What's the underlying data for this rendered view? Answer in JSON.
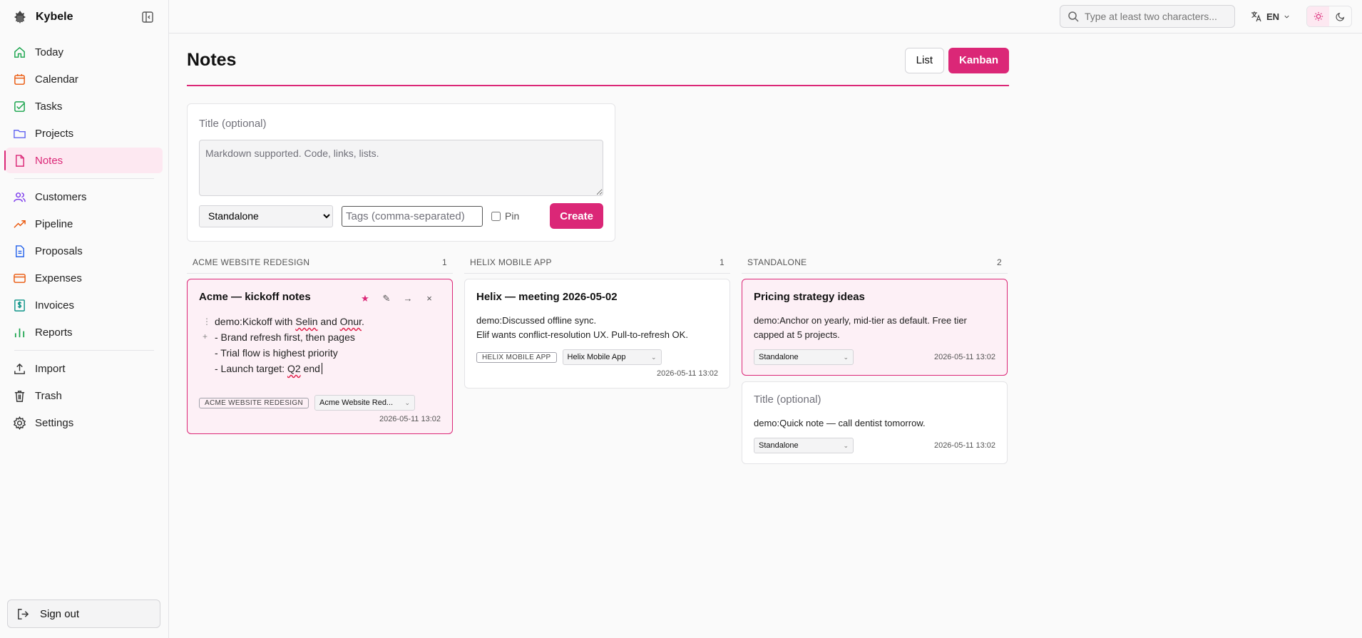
{
  "app": {
    "name": "Kybele"
  },
  "nav": {
    "primary": [
      {
        "key": "today",
        "label": "Today",
        "color": "#16a34a"
      },
      {
        "key": "calendar",
        "label": "Calendar",
        "color": "#ea580c"
      },
      {
        "key": "tasks",
        "label": "Tasks",
        "color": "#16a34a"
      },
      {
        "key": "projects",
        "label": "Projects",
        "color": "#6366f1"
      },
      {
        "key": "notes",
        "label": "Notes",
        "color": "#db2777"
      }
    ],
    "business": [
      {
        "key": "customers",
        "label": "Customers",
        "color": "#7c3aed"
      },
      {
        "key": "pipeline",
        "label": "Pipeline",
        "color": "#ea580c"
      },
      {
        "key": "proposals",
        "label": "Proposals",
        "color": "#2563eb"
      },
      {
        "key": "expenses",
        "label": "Expenses",
        "color": "#ea580c"
      },
      {
        "key": "invoices",
        "label": "Invoices",
        "color": "#0d9488"
      },
      {
        "key": "reports",
        "label": "Reports",
        "color": "#16a34a"
      }
    ],
    "system": [
      {
        "key": "import",
        "label": "Import",
        "color": "#333"
      },
      {
        "key": "trash",
        "label": "Trash",
        "color": "#333"
      },
      {
        "key": "settings",
        "label": "Settings",
        "color": "#333"
      }
    ],
    "sign_out": "Sign out"
  },
  "topbar": {
    "search_placeholder": "Type at least two characters...",
    "language": "EN"
  },
  "page": {
    "title": "Notes",
    "view_list": "List",
    "view_kanban": "Kanban"
  },
  "composer": {
    "title_placeholder": "Title (optional)",
    "body_placeholder": "Markdown supported. Code, links, lists.",
    "project_selected": "Standalone",
    "tags_placeholder": "Tags (comma-separated)",
    "pin_label": "Pin",
    "create_label": "Create"
  },
  "columns": [
    {
      "name": "ACME WEBSITE REDESIGN",
      "count": "1"
    },
    {
      "name": "HELIX MOBILE APP",
      "count": "1"
    },
    {
      "name": "STANDALONE",
      "count": "2"
    }
  ],
  "cards": {
    "acme": {
      "title": "Acme — kickoff notes",
      "actions": {
        "pin": "★",
        "edit": "✎",
        "move": "→",
        "delete": "×"
      },
      "lines": [
        "demo:Kickoff with ",
        "Selin",
        " and ",
        "Onur",
        ".",
        "- Brand refresh first, then pages",
        "- Trial flow is highest priority",
        "- Launch target: ",
        "Q2",
        " end"
      ],
      "badge": "ACME WEBSITE REDESIGN",
      "project": "Acme Website Red...",
      "timestamp": "2026-05-11 13:02"
    },
    "helix": {
      "title": "Helix — meeting 2026-05-02",
      "body_1": "demo:Discussed offline sync.",
      "body_2": "Elif wants conflict-resolution UX. Pull-to-refresh OK.",
      "badge": "HELIX MOBILE APP",
      "project": "Helix Mobile App",
      "timestamp": "2026-05-11 13:02"
    },
    "pricing": {
      "title": "Pricing strategy ideas",
      "body": "demo:Anchor on yearly, mid-tier as default. Free tier capped at 5 projects.",
      "project": "Standalone",
      "timestamp": "2026-05-11 13:02"
    },
    "quick": {
      "title": "Title (optional)",
      "body": "demo:Quick note — call dentist tomorrow.",
      "project": "Standalone",
      "timestamp": "2026-05-11 13:02"
    }
  },
  "colors": {
    "accent": "#db2777",
    "accent_soft": "#fde8f1"
  }
}
